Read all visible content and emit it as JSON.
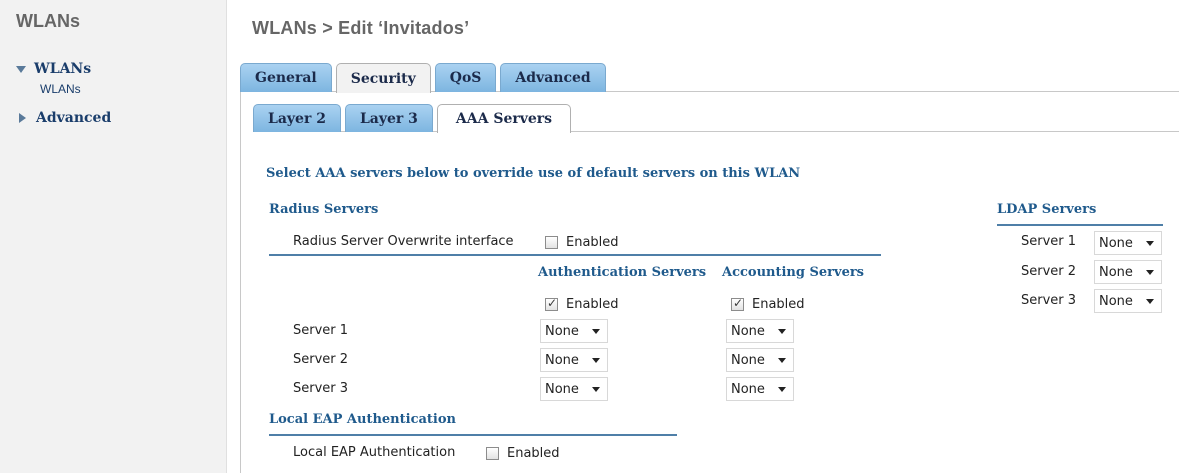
{
  "sidebar": {
    "title": "WLANs",
    "items": [
      {
        "label": "WLANs",
        "sub": "WLANs"
      },
      {
        "label": "Advanced"
      }
    ]
  },
  "page_title": "WLANs > Edit  ‘Invitados’",
  "tabs": [
    "General",
    "Security",
    "QoS",
    "Advanced"
  ],
  "active_tab": "Security",
  "subtabs": [
    "Layer 2",
    "Layer 3",
    "AAA Servers"
  ],
  "active_subtab": "AAA Servers",
  "intro": "Select AAA servers below to override use of default servers on this WLAN",
  "radius": {
    "heading": "Radius Servers",
    "overwrite_label": "Radius Server Overwrite interface",
    "overwrite_enabled_label": "Enabled",
    "auth_heading": "Authentication Servers",
    "acct_heading": "Accounting Servers",
    "auth_enabled_label": "Enabled",
    "acct_enabled_label": "Enabled",
    "rows": [
      {
        "label": "Server 1",
        "auth": "None",
        "acct": "None"
      },
      {
        "label": "Server 2",
        "auth": "None",
        "acct": "None"
      },
      {
        "label": "Server 3",
        "auth": "None",
        "acct": "None"
      }
    ]
  },
  "local_eap": {
    "heading": "Local EAP Authentication",
    "label": "Local EAP Authentication",
    "enabled_label": "Enabled"
  },
  "ldap": {
    "heading": "LDAP Servers",
    "rows": [
      {
        "label": "Server 1",
        "value": "None"
      },
      {
        "label": "Server 2",
        "value": "None"
      },
      {
        "label": "Server 3",
        "value": "None"
      }
    ]
  }
}
